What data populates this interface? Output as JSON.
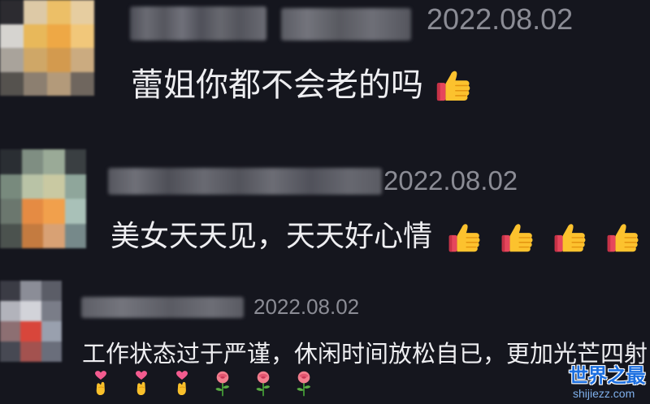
{
  "colors": {
    "background": "#15161e",
    "comment_text": "#eeeef1",
    "date_text": "#8b8c95",
    "watermark_title": "#1c6fe0",
    "watermark_url": "#7fb0ec"
  },
  "comments": [
    {
      "date": "2022.08.02",
      "text": "蕾姐你都不会老的吗",
      "emojis": [
        "thumbs-up"
      ],
      "avatar_mosaic": [
        "#2c2b30",
        "#ddc9a6",
        "#ecbf67",
        "#e6cda0",
        "#d6d4d0",
        "#e8b85a",
        "#eea845",
        "#f1c77a",
        "#a9a39b",
        "#cfa767",
        "#d39a4e",
        "#cbab80",
        "#55524e",
        "#8c7f70",
        "#b39a7a",
        "#6f665e"
      ]
    },
    {
      "date": "2022.08.02",
      "text": "美女天天见，天天好心情",
      "emojis": [
        "thumbs-up",
        "thumbs-up",
        "thumbs-up",
        "thumbs-up"
      ],
      "avatar_mosaic": [
        "#2a2e33",
        "#7f8e82",
        "#9aaa97",
        "#3a3f42",
        "#788a7d",
        "#b9c3a6",
        "#c9c9a2",
        "#8fa69b",
        "#6b776e",
        "#e58b43",
        "#f1a04c",
        "#a9c1b8",
        "#4b524e",
        "#c47b40",
        "#d8a174",
        "#76898a"
      ]
    },
    {
      "date": "2022.08.02",
      "text": "工作状态过于严谨，休闲时间放松自已，更加光芒四射",
      "emojis": [
        "finger-heart",
        "finger-heart",
        "finger-heart",
        "rose",
        "rose",
        "rose"
      ],
      "avatar_mosaic": [
        "#3b3c45",
        "#8b8d97",
        "#5b5d67",
        "#b2b3bb",
        "#d2d3d9",
        "#7a7d88",
        "#8d6f72",
        "#d8463b",
        "#99a0ae",
        "#474953",
        "#a3524f",
        "#6a6e7b"
      ]
    }
  ],
  "watermark": {
    "title": "世界之最",
    "url": "shijiezz.com"
  }
}
